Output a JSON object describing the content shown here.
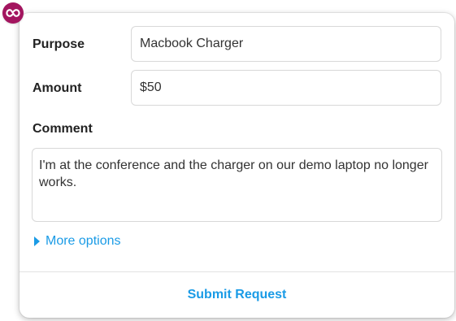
{
  "app": {
    "badge_icon": "infinity-link-icon",
    "badge_color": "#a3155f"
  },
  "form": {
    "purpose": {
      "label": "Purpose",
      "value": "Macbook Charger"
    },
    "amount": {
      "label": "Amount",
      "value": "$50"
    },
    "comment": {
      "label": "Comment",
      "value": "I'm at the conference and the charger on our demo laptop no longer works."
    },
    "more_options": {
      "label": "More options",
      "icon": "caret-right-icon"
    },
    "submit_label": "Submit Request"
  },
  "colors": {
    "accent": "#1a9be6",
    "text": "#222222",
    "border": "#d8d8d8"
  }
}
